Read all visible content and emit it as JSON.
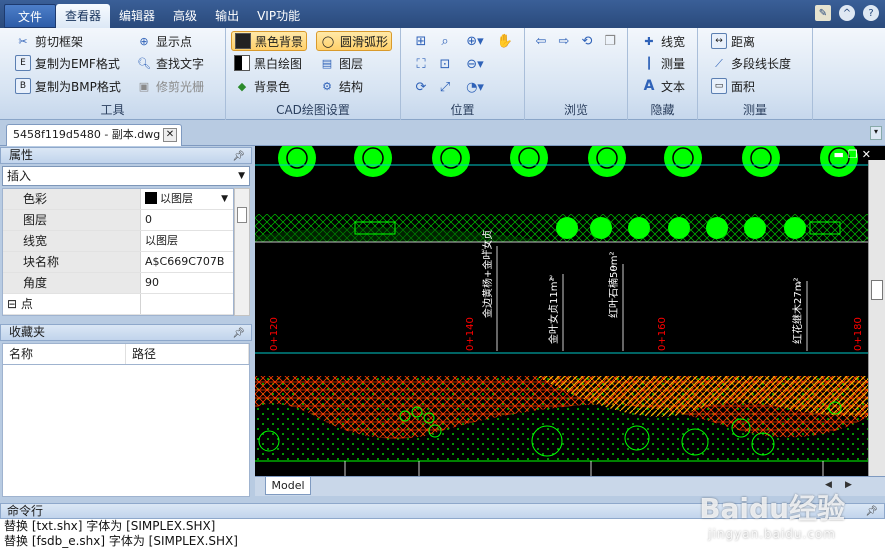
{
  "menu": {
    "file": "文件",
    "tabs": [
      "查看器",
      "编辑器",
      "高级",
      "输出",
      "VIP功能"
    ],
    "active": 0
  },
  "ribbon": {
    "groups": {
      "tools": {
        "label": "工具",
        "items": {
          "clip_frame": "剪切框架",
          "copy_emf": "复制为EMF格式",
          "copy_bmp": "复制为BMP格式",
          "show_points": "显示点",
          "find_text": "查找文字",
          "trim_raster": "修剪光栅"
        }
      },
      "cad_settings": {
        "label": "CAD绘图设置",
        "items": {
          "black_bg": "黑色背景",
          "smooth_arc": "圆滑弧形",
          "bw_draw": "黑白绘图",
          "layers": "图层",
          "bg_color": "背景色",
          "structure": "结构"
        }
      },
      "position": {
        "label": "位置"
      },
      "browse": {
        "label": "浏览"
      },
      "hide": {
        "label": "隐藏",
        "items": {
          "lineweight": "线宽",
          "measure": "测量",
          "text": "文本"
        }
      },
      "measure": {
        "label": "测量",
        "items": {
          "distance": "距离",
          "polyline_length": "多段线长度",
          "area": "面积"
        }
      }
    }
  },
  "document": {
    "tab_name": "5458f119d5480 - 副本.dwg"
  },
  "properties": {
    "title": "属性",
    "selector": "插入",
    "rows": [
      {
        "key": "色彩",
        "value": "以图层",
        "type": "color"
      },
      {
        "key": "图层",
        "value": "0"
      },
      {
        "key": "线宽",
        "value": "以图层"
      },
      {
        "key": "块名称",
        "value": "A$C669C707B"
      },
      {
        "key": "角度",
        "value": "90"
      }
    ],
    "category": "点"
  },
  "favorites": {
    "title": "收藏夹",
    "columns": [
      "名称",
      "路径"
    ]
  },
  "canvas": {
    "layout_tab": "Model",
    "station_labels": [
      "0+120",
      "0+140",
      "0+160",
      "0+180"
    ],
    "callouts": [
      "金边黄杨+金叶女贞",
      "金叶女贞11m²",
      "红叶石楠50m²",
      "红花继木27m²"
    ],
    "callout_marks": [
      "3",
      "3",
      "3",
      "3"
    ]
  },
  "command": {
    "title": "命令行",
    "lines": [
      "替换 [txt.shx] 字体为 [SIMPLEX.SHX]",
      "替换 [fsdb_e.shx] 字体为 [SIMPLEX.SHX]"
    ]
  },
  "watermark": {
    "brand": "Baidu经验",
    "url": "jingyan.baidu.com"
  },
  "colors": {
    "accent": "#2a4a7c",
    "cad_green": "#00ff00",
    "cad_cyan": "#00ffff",
    "cad_red": "#ff0000",
    "cad_orange": "#ff8800"
  }
}
